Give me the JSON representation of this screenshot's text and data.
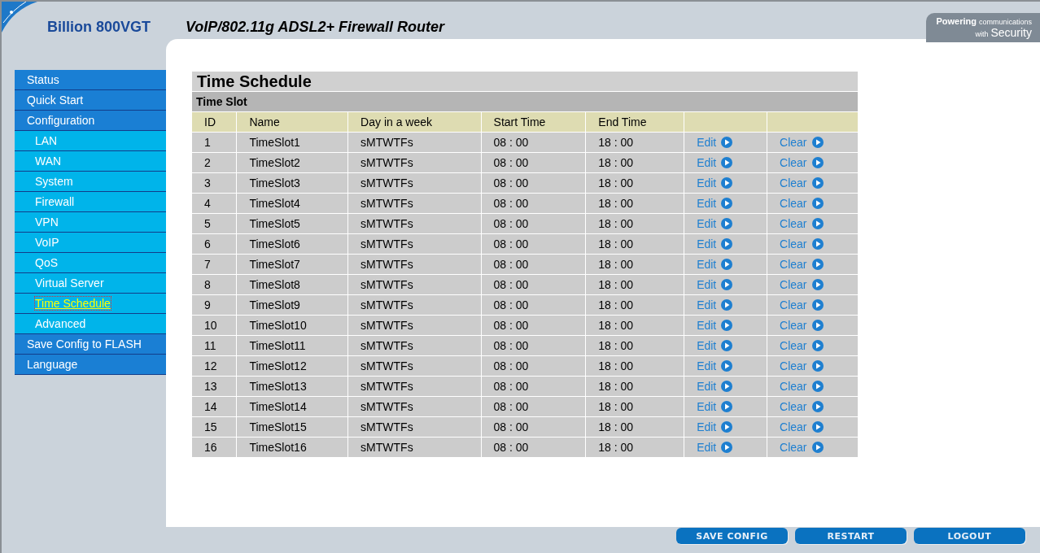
{
  "header": {
    "brand": "Billion 800VGT",
    "title": "VoIP/802.11g ADSL2+ Firewall Router",
    "slogan": [
      "Powering",
      "communications",
      "with",
      "Security"
    ]
  },
  "sidebar": {
    "items": [
      {
        "label": "Status",
        "kind": "main",
        "selected": false
      },
      {
        "label": "Quick Start",
        "kind": "main",
        "selected": false
      },
      {
        "label": "Configuration",
        "kind": "main",
        "selected": false
      },
      {
        "label": "LAN",
        "kind": "sub",
        "selected": false
      },
      {
        "label": "WAN",
        "kind": "sub",
        "selected": false
      },
      {
        "label": "System",
        "kind": "sub",
        "selected": false
      },
      {
        "label": "Firewall",
        "kind": "sub",
        "selected": false
      },
      {
        "label": "VPN",
        "kind": "sub",
        "selected": false
      },
      {
        "label": "VoIP",
        "kind": "sub",
        "selected": false
      },
      {
        "label": "QoS",
        "kind": "sub",
        "selected": false
      },
      {
        "label": "Virtual Server",
        "kind": "sub",
        "selected": false
      },
      {
        "label": "Time Schedule",
        "kind": "sub",
        "selected": true
      },
      {
        "label": "Advanced",
        "kind": "sub",
        "selected": false
      },
      {
        "label": "Save Config to FLASH",
        "kind": "main",
        "selected": false
      },
      {
        "label": "Language",
        "kind": "main",
        "selected": false
      }
    ]
  },
  "panel": {
    "title": "Time Schedule",
    "section": "Time Slot",
    "columns": [
      "ID",
      "Name",
      "Day in a week",
      "Start Time",
      "End Time"
    ],
    "rows": [
      {
        "id": "1",
        "name": "TimeSlot1",
        "days": "sMTWTFs",
        "start": "08 : 00",
        "end": "18 : 00",
        "edit": "Edit",
        "clear": "Clear"
      },
      {
        "id": "2",
        "name": "TimeSlot2",
        "days": "sMTWTFs",
        "start": "08 : 00",
        "end": "18 : 00",
        "edit": "Edit",
        "clear": "Clear"
      },
      {
        "id": "3",
        "name": "TimeSlot3",
        "days": "sMTWTFs",
        "start": "08 : 00",
        "end": "18 : 00",
        "edit": "Edit",
        "clear": "Clear"
      },
      {
        "id": "4",
        "name": "TimeSlot4",
        "days": "sMTWTFs",
        "start": "08 : 00",
        "end": "18 : 00",
        "edit": "Edit",
        "clear": "Clear"
      },
      {
        "id": "5",
        "name": "TimeSlot5",
        "days": "sMTWTFs",
        "start": "08 : 00",
        "end": "18 : 00",
        "edit": "Edit",
        "clear": "Clear"
      },
      {
        "id": "6",
        "name": "TimeSlot6",
        "days": "sMTWTFs",
        "start": "08 : 00",
        "end": "18 : 00",
        "edit": "Edit",
        "clear": "Clear"
      },
      {
        "id": "7",
        "name": "TimeSlot7",
        "days": "sMTWTFs",
        "start": "08 : 00",
        "end": "18 : 00",
        "edit": "Edit",
        "clear": "Clear"
      },
      {
        "id": "8",
        "name": "TimeSlot8",
        "days": "sMTWTFs",
        "start": "08 : 00",
        "end": "18 : 00",
        "edit": "Edit",
        "clear": "Clear"
      },
      {
        "id": "9",
        "name": "TimeSlot9",
        "days": "sMTWTFs",
        "start": "08 : 00",
        "end": "18 : 00",
        "edit": "Edit",
        "clear": "Clear"
      },
      {
        "id": "10",
        "name": "TimeSlot10",
        "days": "sMTWTFs",
        "start": "08 : 00",
        "end": "18 : 00",
        "edit": "Edit",
        "clear": "Clear"
      },
      {
        "id": "11",
        "name": "TimeSlot11",
        "days": "sMTWTFs",
        "start": "08 : 00",
        "end": "18 : 00",
        "edit": "Edit",
        "clear": "Clear"
      },
      {
        "id": "12",
        "name": "TimeSlot12",
        "days": "sMTWTFs",
        "start": "08 : 00",
        "end": "18 : 00",
        "edit": "Edit",
        "clear": "Clear"
      },
      {
        "id": "13",
        "name": "TimeSlot13",
        "days": "sMTWTFs",
        "start": "08 : 00",
        "end": "18 : 00",
        "edit": "Edit",
        "clear": "Clear"
      },
      {
        "id": "14",
        "name": "TimeSlot14",
        "days": "sMTWTFs",
        "start": "08 : 00",
        "end": "18 : 00",
        "edit": "Edit",
        "clear": "Clear"
      },
      {
        "id": "15",
        "name": "TimeSlot15",
        "days": "sMTWTFs",
        "start": "08 : 00",
        "end": "18 : 00",
        "edit": "Edit",
        "clear": "Clear"
      },
      {
        "id": "16",
        "name": "TimeSlot16",
        "days": "sMTWTFs",
        "start": "08 : 00",
        "end": "18 : 00",
        "edit": "Edit",
        "clear": "Clear"
      }
    ]
  },
  "footer": {
    "buttons": [
      "SAVE CONFIG",
      "RESTART",
      "LOGOUT"
    ]
  }
}
